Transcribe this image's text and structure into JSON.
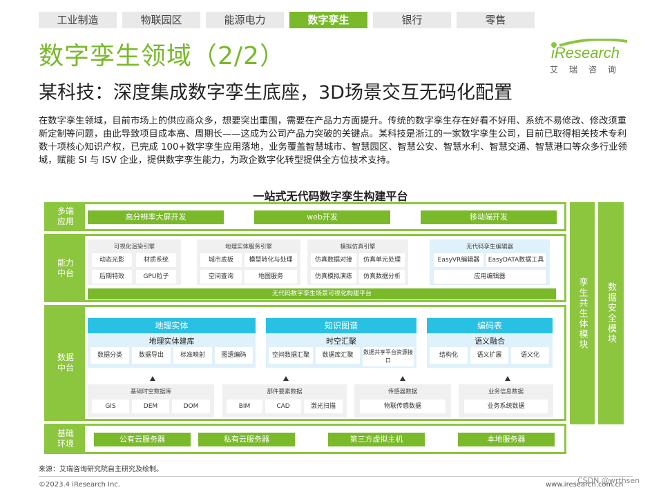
{
  "tabs": [
    "工业制造",
    "物联园区",
    "能源电力",
    "数字孪生",
    "银行",
    "零售"
  ],
  "active_tab": "数字孪生",
  "title": "数字孪生领域（2/2）",
  "subtitle": "某科技：深度集成数字孪生底座，3D场景交互无码化配置",
  "logo": {
    "name": "iResearch",
    "sub": "艾瑞咨询"
  },
  "paragraph": "在数字孪生领域，目前市场上的供应商众多，想要突出重围，需要在产品力方面提升。传统的数字孪生存在好看不好用、系统不易修改、修改须重新定制等问题，由此导致项目成本高、周期长——这成为公司产品力突破的关键点。某科技是浙江的一家数字孪生公司，目前已取得相关技术专利数十项核心知识产权，已完成 100+数字孪生应用落地，业务覆盖智慧城市、智慧园区、智慧公安、智慧水利、智慧交通、智慧港口等众多行业领域，赋能 SI 与 ISV 企业，提供数字孪生能力，为政企数字化转型提供全方位技术支持。",
  "diagram": {
    "title": "一站式无代码数字孪生构建平台",
    "app_layer": {
      "label": "多端应用",
      "items": [
        "高分辨率大屏开发",
        "web开发",
        "移动端开发"
      ]
    },
    "cap_layer": {
      "label": "能力中台",
      "groups": [
        {
          "title": "可视化渲染引擎",
          "items": [
            "动态光影",
            "材质系统",
            "后期特效",
            "GPU粒子"
          ]
        },
        {
          "title": "地理实体服务引擎",
          "items": [
            "城市底板",
            "模型转化与处理",
            "空间查询",
            "地图服务"
          ]
        },
        {
          "title": "模拟仿真引擎",
          "items": [
            "仿真数据对接",
            "仿真单元处理",
            "仿真模拟演练",
            "仿真数据分析"
          ]
        },
        {
          "title": "无代码孪生编辑器",
          "items": [
            "EasyVR编辑器",
            "EasyDATA数据工具",
            "应用编辑器"
          ]
        }
      ],
      "bar": "无代码数字孪生场景可视化构建平台"
    },
    "data_layer": {
      "label": "数据中台",
      "sections": [
        {
          "header": "地理实体",
          "title": "地理实体建库",
          "items": [
            "数据分类",
            "数据导出",
            "标准映射",
            "图遗编码"
          ]
        },
        {
          "header": "知识图谱",
          "title": "时空汇聚",
          "items": [
            "空间数据汇聚",
            "数据库汇聚",
            "数据共享平台资源接口"
          ]
        },
        {
          "header": "编码表",
          "title": "语义融合",
          "items": [
            "结构化",
            "语义扩展",
            "语义化"
          ]
        }
      ],
      "sources": [
        {
          "title": "基础时空数据库",
          "items": [
            "GIS",
            "DEM",
            "DOM"
          ]
        },
        {
          "title": "部件要素数据",
          "items": [
            "BIM",
            "CAD",
            "激光扫描"
          ]
        },
        {
          "title": "传感器数据",
          "items": [
            "物联传感数据"
          ]
        },
        {
          "title": "业务信息数据",
          "items": [
            "业务系统数据"
          ]
        }
      ]
    },
    "base_layer": {
      "label": "基础环境",
      "items": [
        "公有云服务器",
        "私有云服务器",
        "第三方虚拟主机",
        "本地服务器"
      ]
    },
    "side_columns": [
      "孪生共生体模块",
      "数据安全模块"
    ]
  },
  "footer": {
    "source": "来源：艾瑞咨询研究院自主研究及绘制。",
    "copyright": "©2023.4 iResearch Inc.",
    "url": "www.iresearch.com.cn"
  },
  "watermark": "CSDN @wrthsen"
}
